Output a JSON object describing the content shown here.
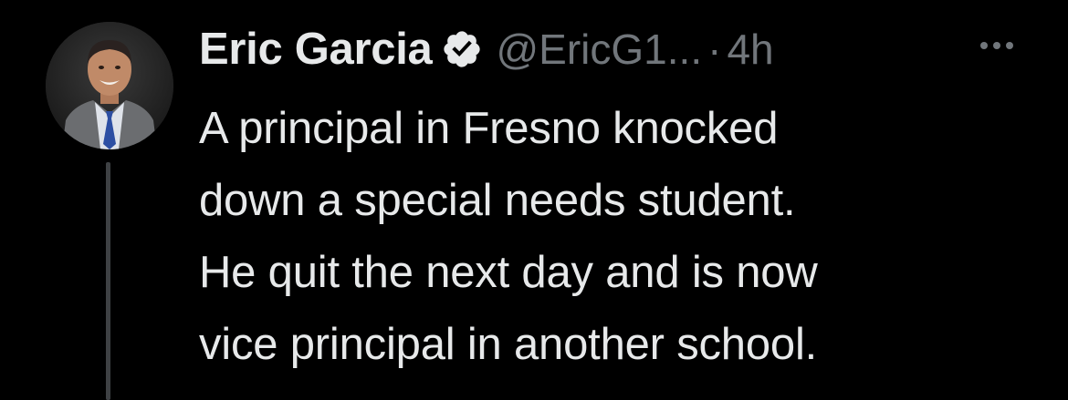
{
  "author": {
    "display_name": "Eric Garcia",
    "handle": "@EricG1...",
    "separator": "·",
    "timestamp": "4h",
    "verified": true,
    "avatar_icon": "person-photo-avatar"
  },
  "tweet": {
    "lines": [
      "A principal in Fresno knocked",
      "down a special needs student.",
      "He quit the next day and is now",
      "vice principal in another school."
    ]
  },
  "actions": {
    "more_icon": "more-horizontal-icon"
  },
  "colors": {
    "background": "#000000",
    "primary_text": "#e7e9ea",
    "secondary_text": "#71767b",
    "thread_line": "#3e4144",
    "verified_badge": "#e7e9ea"
  }
}
